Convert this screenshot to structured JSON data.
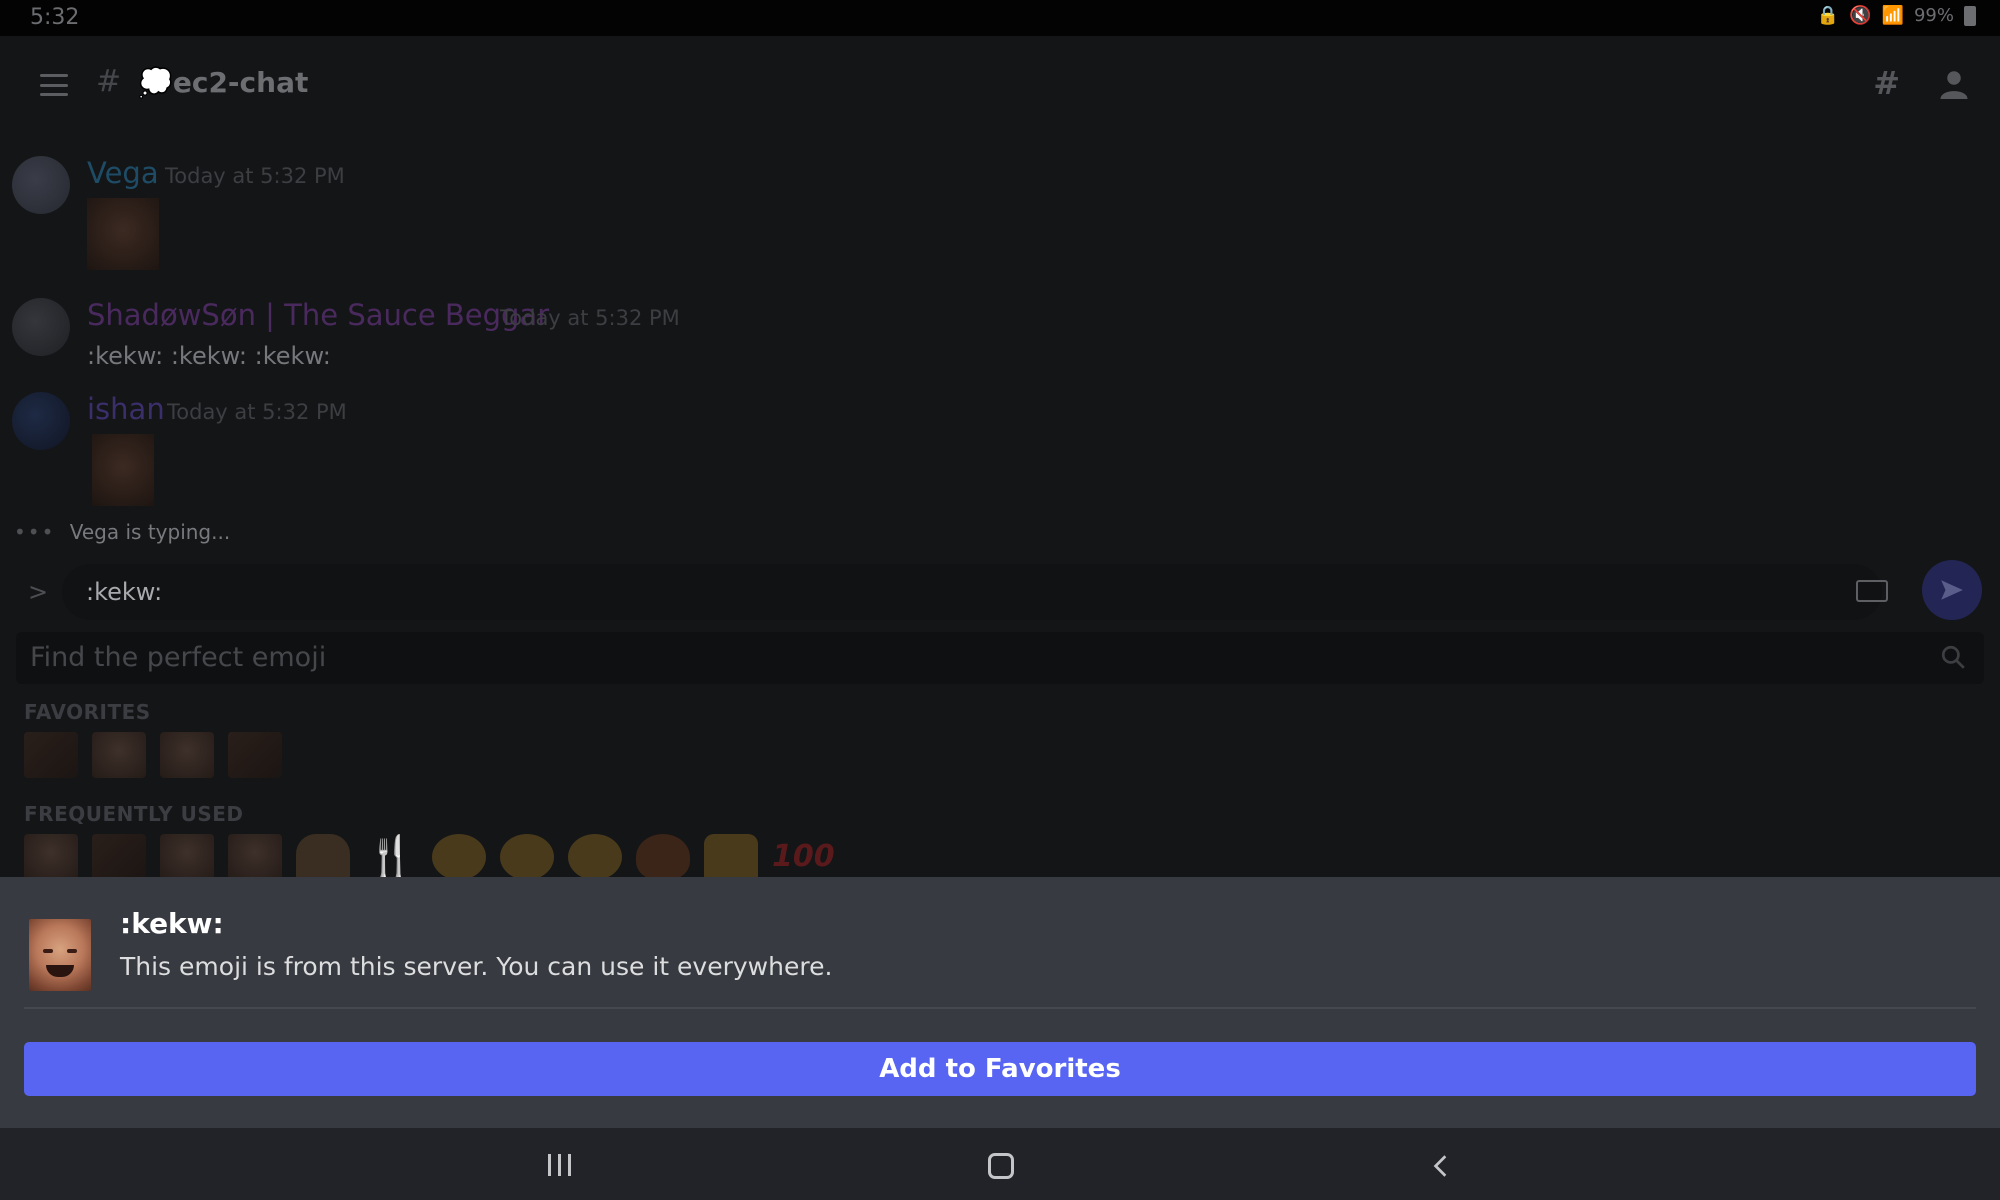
{
  "status_bar": {
    "time": "5:32",
    "battery": "99%"
  },
  "header": {
    "channel_name": "💭ec2-chat"
  },
  "messages": [
    {
      "username": "Vega",
      "timestamp": "Today at 5:32 PM",
      "color": "#1e4c66"
    },
    {
      "username": "ShadøwSøn | The Sauce Beggar",
      "timestamp": "Today at 5:32 PM",
      "text": ":kekw: :kekw: :kekw:",
      "color": "#4a2a5e"
    },
    {
      "username": "ishan",
      "timestamp": "Today at 5:32 PM",
      "color": "#3b2f6b"
    }
  ],
  "typing": {
    "text": "Vega is typing..."
  },
  "input": {
    "value": ":kekw:"
  },
  "emoji_picker": {
    "search_placeholder": "Find the perfect emoji",
    "favorites_title": "FAVORITES",
    "frequently_used_title": "FREQUENTLY USED",
    "hundred_label": "100"
  },
  "sheet": {
    "emoji_name": ":kekw:",
    "description": "This emoji is from this server. You can use it everywhere.",
    "add_favorites_label": "Add to Favorites"
  },
  "colors": {
    "accent": "#5865f2",
    "sheet_bg": "#373a40"
  }
}
